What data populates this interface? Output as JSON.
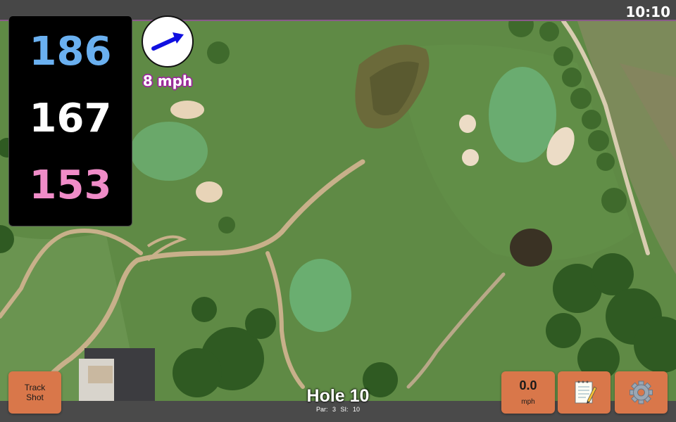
{
  "status_bar": {
    "clock": "10:10"
  },
  "yardages": {
    "back": "186",
    "middle": "167",
    "front": "153",
    "colors": {
      "back": "#6ab0f0",
      "middle": "#ffffff",
      "front": "#f08cc8"
    }
  },
  "wind": {
    "speed": "8 mph",
    "direction_icon": "arrow-icon",
    "arrow_color": "#1010e0"
  },
  "map": {
    "type": "satellite-aerial",
    "subject": "golf-course"
  },
  "buttons": {
    "track_shot": {
      "line1": "Track",
      "line2": "Shot"
    },
    "speed": {
      "value": "0.0",
      "unit": "mph"
    },
    "notes": {
      "icon": "notepad-icon"
    },
    "settings": {
      "icon": "gear-icon"
    },
    "accent_color": "#d9774a"
  },
  "hole": {
    "title": "Hole 10",
    "info": "Par: 3 SI: 10"
  }
}
